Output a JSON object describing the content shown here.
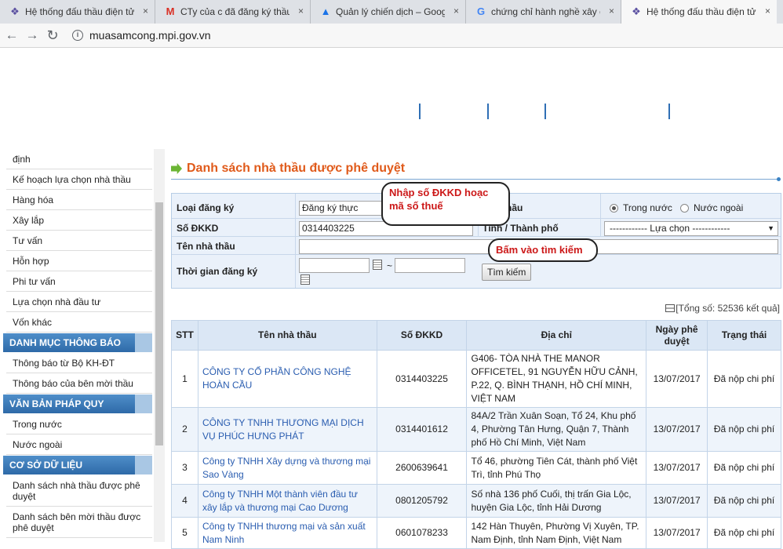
{
  "browser": {
    "tabs": [
      {
        "title": "Hệ thống đấu thầu điện tử",
        "icon": "❖",
        "icon_color": "#5a4fa0",
        "active": false
      },
      {
        "title": "CTy của c đã đăng ký thầu",
        "icon": "M",
        "icon_color": "#d93025",
        "active": false
      },
      {
        "title": "Quản lý chiến dịch – Google",
        "icon": "▲",
        "icon_color": "#1a73e8",
        "active": false
      },
      {
        "title": "chứng chỉ hành nghề xây dựng",
        "icon": "G",
        "icon_color": "#4285f4",
        "active": false
      },
      {
        "title": "Hệ thống đấu thầu điện tử",
        "icon": "❖",
        "icon_color": "#5a4fa0",
        "active": true
      }
    ],
    "close_glyph": "×",
    "back_glyph": "←",
    "forward_glyph": "→",
    "reload_glyph": "↻",
    "info_glyph": "i",
    "url": "muasamcong.mpi.gov.vn"
  },
  "sidebar": {
    "items": [
      {
        "label": "định",
        "type": "item"
      },
      {
        "label": "Kế hoạch lựa chọn nhà thầu",
        "type": "item"
      },
      {
        "label": "Hàng hóa",
        "type": "item"
      },
      {
        "label": "Xây lắp",
        "type": "item"
      },
      {
        "label": "Tư vấn",
        "type": "item"
      },
      {
        "label": "Hỗn hợp",
        "type": "item"
      },
      {
        "label": "Phi tư vấn",
        "type": "item"
      },
      {
        "label": "Lựa chọn nhà đầu tư",
        "type": "item"
      },
      {
        "label": "Vốn khác",
        "type": "item"
      },
      {
        "label": "DANH MỤC THÔNG BÁO",
        "type": "head"
      },
      {
        "label": "Thông báo từ Bộ KH-ĐT",
        "type": "item"
      },
      {
        "label": "Thông báo của bên mời thầu",
        "type": "item"
      },
      {
        "label": "VĂN BẢN PHÁP QUY",
        "type": "head"
      },
      {
        "label": "Trong nước",
        "type": "item"
      },
      {
        "label": "Nước ngoài",
        "type": "item"
      },
      {
        "label": "CƠ SỞ DỮ LIỆU",
        "type": "head"
      },
      {
        "label": "Danh sách nhà thầu được phê duyệt",
        "type": "item2"
      },
      {
        "label": "Danh sách bên mời thầu được phê duyệt",
        "type": "item2"
      }
    ]
  },
  "page": {
    "title": "Danh sách nhà thầu được phê duyệt"
  },
  "form": {
    "loai_dang_ky_label": "Loại đăng ký",
    "loai_dang_ky_value": "Đăng ký thực",
    "nha_thau_label": "Nhà thầu",
    "radio_trong_nuoc": "Trong nước",
    "radio_nuoc_ngoai": "Nước ngoài",
    "so_dkkd_label": "Số ĐKKD",
    "so_dkkd_value": "0314403225",
    "tinh_label": "Tỉnh / Thành phố",
    "tinh_value": "------------ Lựa chọn ------------",
    "ten_nha_thau_label": "Tên nhà thầu",
    "thoi_gian_label": "Thời gian đăng ký",
    "date_sep": "~",
    "search_button": "Tìm kiếm",
    "dropdown_glyph": "▼"
  },
  "annotations": {
    "bubble1": "Nhập số ĐKKD hoạc mã số thuế",
    "bubble2": "Bấm vào tìm kiếm"
  },
  "results": {
    "total_text": "[Tổng số: 52536 kết quả]",
    "columns": [
      "STT",
      "Tên nhà thầu",
      "Số ĐKKD",
      "Địa chỉ",
      "Ngày phê duyệt",
      "Trạng thái"
    ],
    "rows": [
      {
        "stt": "1",
        "name": "CÔNG TY CỔ PHẦN CÔNG NGHỆ HOÀN CẦU",
        "dkkd": "0314403225",
        "address": "G406- TÒA NHÀ THE MANOR OFFICETEL, 91 NGUYỄN HỮU CẢNH, P.22, Q. BÌNH THẠNH, HỒ CHÍ MINH, VIỆT NAM",
        "date": "13/07/2017",
        "status": "Đã nộp chi phí"
      },
      {
        "stt": "2",
        "name": "CÔNG TY TNHH THƯƠNG MẠI DỊCH VỤ PHÚC HƯNG PHÁT",
        "dkkd": "0314401612",
        "address": "84A/2 Trần Xuân Soạn, Tổ 24, Khu phố 4, Phường Tân Hưng, Quận 7, Thành phố Hồ Chí Minh, Việt Nam",
        "date": "13/07/2017",
        "status": "Đã nộp chi phí"
      },
      {
        "stt": "3",
        "name": "Công ty TNHH Xây dựng và thương mại Sao Vàng",
        "dkkd": "2600639641",
        "address": "Tổ 46, phường Tiên Cát, thành phố Việt Trì, tỉnh Phú Thọ",
        "date": "13/07/2017",
        "status": "Đã nộp chi phí"
      },
      {
        "stt": "4",
        "name": "Công ty TNHH Một thành viên đầu tư xây lắp và thương mại Cao Dương",
        "dkkd": "0801205792",
        "address": "Số nhà 136 phố Cuối, thị trấn Gia Lộc, huyện Gia Lộc, tỉnh Hải Dương",
        "date": "13/07/2017",
        "status": "Đã nộp chi phí"
      },
      {
        "stt": "5",
        "name": "Công ty TNHH thương mại và sản xuất Nam Ninh",
        "dkkd": "0601078233",
        "address": "142 Hàn Thuyên, Phường Vị Xuyên, TP. Nam Định, tỉnh Nam Định, Việt Nam",
        "date": "13/07/2017",
        "status": "Đã nộp chi phí"
      }
    ]
  }
}
